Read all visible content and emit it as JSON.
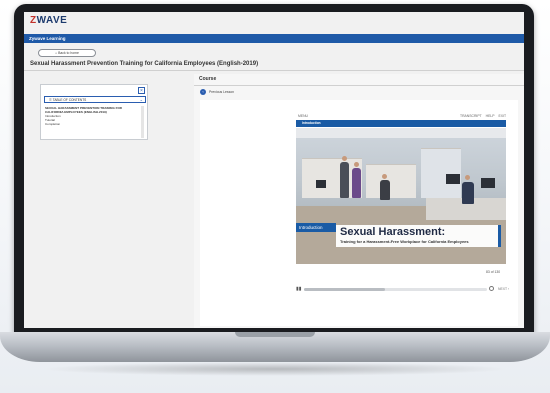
{
  "app": {
    "logo_prefix": "Z",
    "logo_text": "WAVE",
    "bar_title": "Zywave Learning",
    "back_label": "Back to home",
    "course_title": "Sexual Harassment Prevention Training for California Employees (English-2019)"
  },
  "toc": {
    "close_glyph": "×",
    "select_label": "TABLE OF CONTENTS",
    "items": [
      "SEXUAL HARASSMENT PREVENTION TRAINING FOR",
      "CALIFORNIA EMPLOYEES (ENGLISH-2019)",
      "Introduction",
      "Tutorial",
      "Completion"
    ]
  },
  "course": {
    "label": "Course",
    "prev_label": "Previous Lesson",
    "prev_glyph": "‹"
  },
  "player": {
    "menu": "MENU",
    "links": [
      "TRANSCRIPT",
      "HELP",
      "EXIT"
    ],
    "section": "Introduction",
    "intro_tag": "Introduction",
    "title": "Sexual Harassment:",
    "subtitle": "Training for a Harassment-Free Workplace for California Employees",
    "page_count": "83 of 130",
    "progress": 0.44,
    "next_label": "NEXT ›",
    "play_glyph": "▮▮"
  },
  "colors": {
    "accent": "#1f5aa8",
    "brand_red": "#c2312b",
    "brand_navy": "#1d3b6e"
  }
}
